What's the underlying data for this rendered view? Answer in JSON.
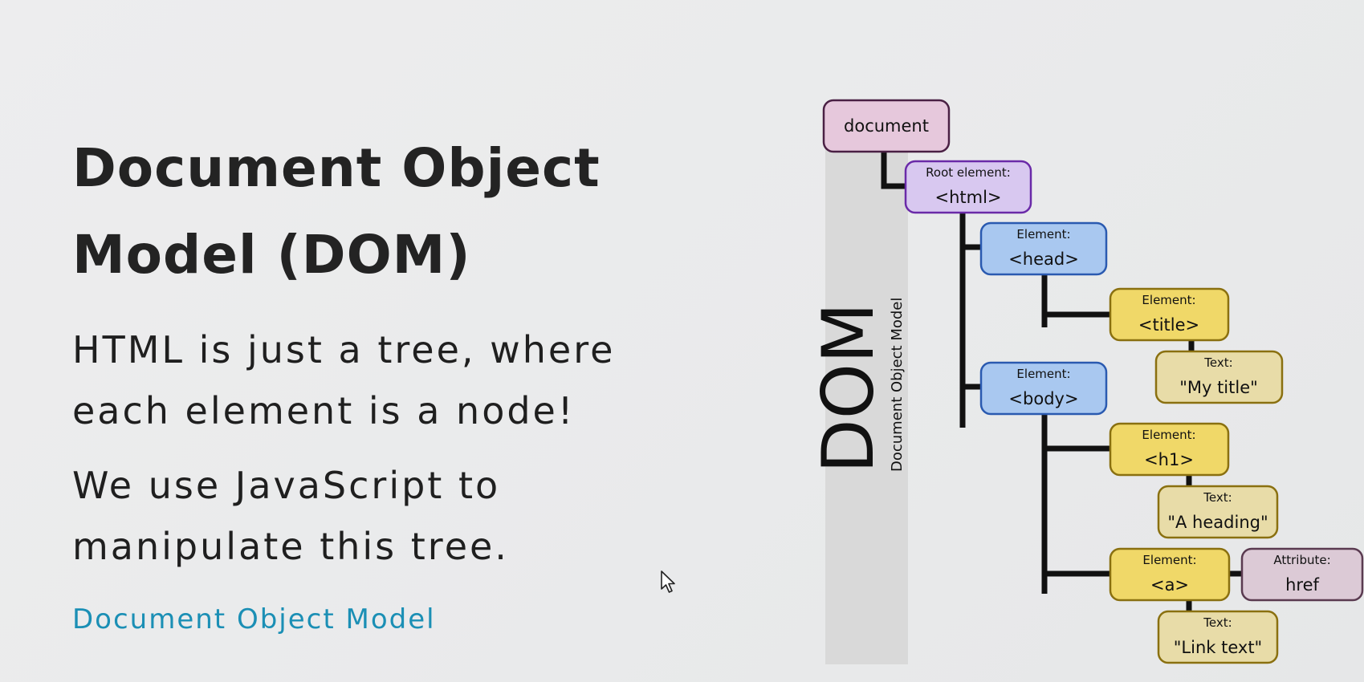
{
  "slide": {
    "title_line1": "Document Object",
    "title_line2": "Model (DOM)",
    "paragraph1_line1": "HTML is just a tree, where",
    "paragraph1_line2": "each element is a node!",
    "paragraph2_line1": "We use JavaScript to",
    "paragraph2_line2": "manipulate this tree.",
    "link_text": "Document Object Model",
    "link_color": "#1b8fb5"
  },
  "diagram": {
    "side_label_big": "DOM",
    "side_label_small": "Document Object Model",
    "nodes": {
      "document": {
        "label": "document"
      },
      "html": {
        "kind": "Root element:",
        "label": "<html>"
      },
      "head": {
        "kind": "Element:",
        "label": "<head>"
      },
      "title": {
        "kind": "Element:",
        "label": "<title>"
      },
      "title_text": {
        "kind": "Text:",
        "label": "\"My title\""
      },
      "body": {
        "kind": "Element:",
        "label": "<body>"
      },
      "h1": {
        "kind": "Element:",
        "label": "<h1>"
      },
      "h1_text": {
        "kind": "Text:",
        "label": "\"A heading\""
      },
      "a": {
        "kind": "Element:",
        "label": "<a>"
      },
      "href_attr": {
        "kind": "Attribute:",
        "label": "href"
      },
      "a_text": {
        "kind": "Text:",
        "label": "\"Link text\""
      }
    },
    "colors": {
      "document_fill": "#e6c8dc",
      "root_fill": "#d8c8f0",
      "element_blue_fill": "#a9c8f0",
      "element_yellow_fill": "#f0d868",
      "text_fill": "#e8dca8",
      "attribute_fill": "#dccad6"
    }
  }
}
